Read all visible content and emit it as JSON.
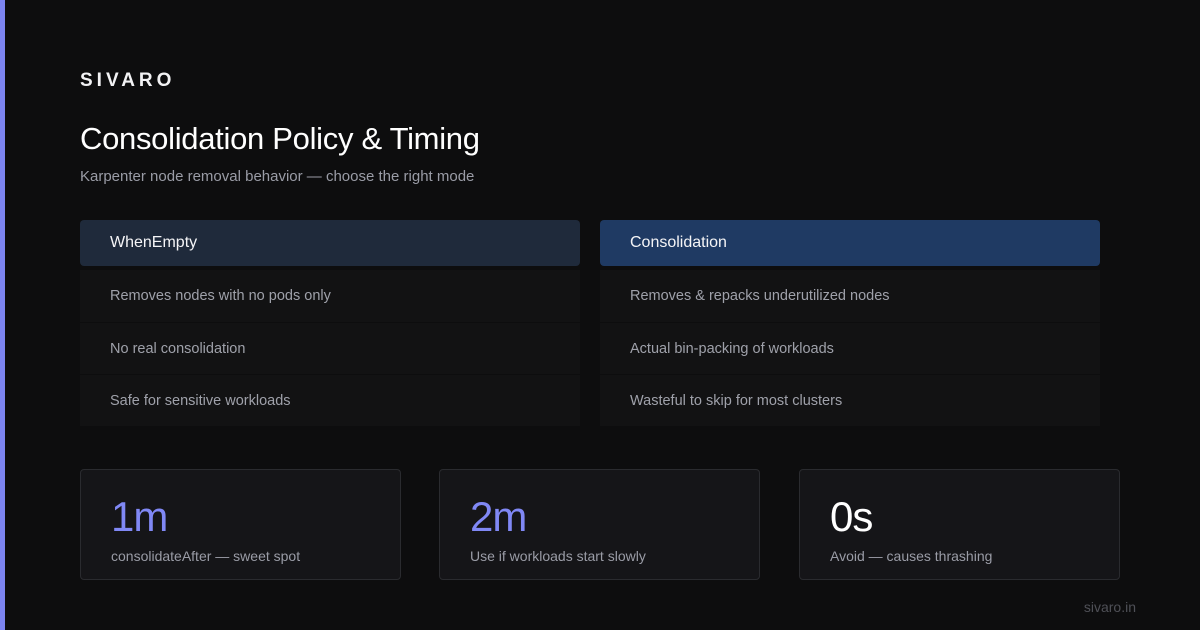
{
  "brand": "SIVARO",
  "title": "Consolidation Policy & Timing",
  "subtitle": "Karpenter node removal behavior — choose the right mode",
  "columns": [
    {
      "header": "WhenEmpty",
      "rows": [
        "Removes nodes with no pods only",
        "No real consolidation",
        "Safe for sensitive workloads"
      ]
    },
    {
      "header": "Consolidation",
      "rows": [
        "Removes & repacks underutilized nodes",
        "Actual bin-packing of workloads",
        "Wasteful to skip for most clusters"
      ]
    }
  ],
  "stats": [
    {
      "value": "1m",
      "label": "consolidateAfter — sweet spot",
      "color": "#8088f5"
    },
    {
      "value": "2m",
      "label": "Use if workloads start slowly",
      "color": "#8088f5"
    },
    {
      "value": "0s",
      "label": "Avoid — causes thrashing",
      "color": "#ffffff"
    }
  ],
  "footer": "sivaro.in",
  "colors": {
    "accent": "#7c84f0",
    "background": "#0d0d0e"
  }
}
